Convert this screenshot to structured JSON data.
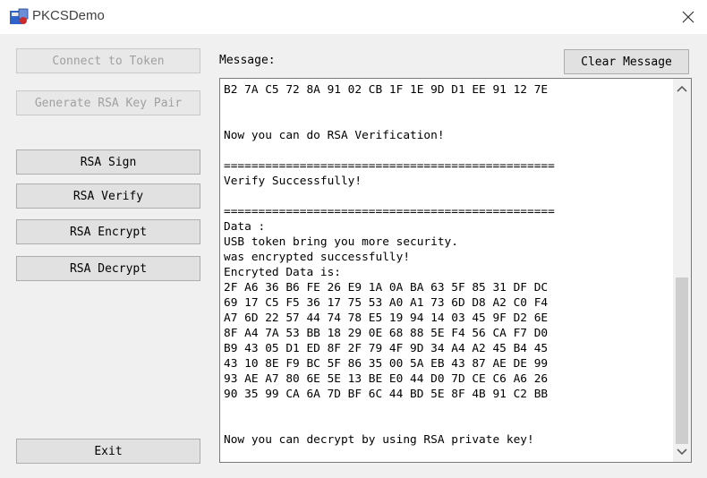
{
  "window": {
    "title": "PKCSDemo",
    "icon": "card-reader-icon",
    "close_icon": "close-icon"
  },
  "buttons": {
    "connect": "Connect to Token",
    "generate": "Generate RSA Key Pair",
    "sign": "RSA Sign",
    "verify": "RSA Verify",
    "encrypt": "RSA Encrypt",
    "decrypt": "RSA Decrypt",
    "exit": "Exit"
  },
  "message": {
    "label": "Message:",
    "clear_label": "Clear Message",
    "lines": [
      "B2 7A C5 72 8A 91 02 CB 1F 1E 9D D1 EE 91 12 7E",
      "",
      "",
      "Now you can do RSA Verification!",
      "",
      "================================================",
      "Verify Successfully!",
      "",
      "================================================",
      "Data :",
      "USB token bring you more security.",
      "was encrypted successfully!",
      "Encryted Data is:",
      "2F A6 36 B6 FE 26 E9 1A 0A BA 63 5F 85 31 DF DC",
      "69 17 C5 F5 36 17 75 53 A0 A1 73 6D D8 A2 C0 F4",
      "A7 6D 22 57 44 74 78 E5 19 94 14 03 45 9F D2 6E",
      "8F A4 7A 53 BB 18 29 0E 68 88 5E F4 56 CA F7 D0",
      "B9 43 05 D1 ED 8F 2F 79 4F 9D 34 A4 A2 45 B4 45",
      "43 10 8E F9 BC 5F 86 35 00 5A EB 43 87 AE DE 99",
      "93 AE A7 80 6E 5E 13 BE E0 44 D0 7D CE C6 A6 26",
      "90 35 99 CA 6A 7D BF 6C 44 BD 5E 8F 4B 91 C2 BB",
      "",
      "",
      "Now you can decrypt by using RSA private key!"
    ]
  },
  "scrollbar": {
    "up_icon": "chevron-up-icon",
    "down_icon": "chevron-down-icon",
    "scroll_position": 1.0
  }
}
